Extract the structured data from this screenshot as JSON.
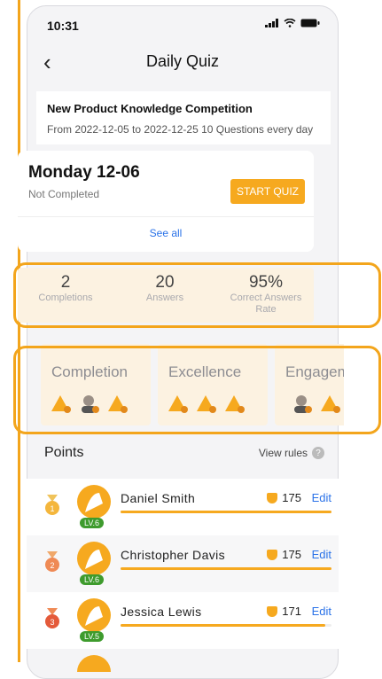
{
  "status_bar": {
    "time": "10:31"
  },
  "nav": {
    "title": "Daily Quiz",
    "back_icon": "chevron-left-icon"
  },
  "competition": {
    "title": "New Product Knowledge Competition",
    "dates": "From 2022-12-05 to 2022-12-25  10 Questions every day"
  },
  "today": {
    "day": "Monday 12-06",
    "status": "Not Completed",
    "start_label": "START QUIZ",
    "see_all": "See all"
  },
  "stats": [
    {
      "value": "2",
      "label": "Completions"
    },
    {
      "value": "20",
      "label": "Answers"
    },
    {
      "value": "95%",
      "label": "Correct Answers Rate"
    }
  ],
  "badges": [
    {
      "name": "Completion",
      "medals": [
        "1",
        "2",
        "3"
      ]
    },
    {
      "name": "Excellence",
      "medals": [
        "1",
        "2",
        "3"
      ]
    },
    {
      "name": "Engagem",
      "medals": [
        "1",
        "2",
        "3"
      ]
    }
  ],
  "points": {
    "title": "Points",
    "view_rules": "View rules",
    "rows": [
      {
        "rank": "1",
        "name": "Daniel Smith",
        "level": "LV.6",
        "score": "175",
        "edit": "Edit",
        "progress": 1.0
      },
      {
        "rank": "2",
        "name": "Christopher Davis",
        "level": "LV.6",
        "score": "175",
        "edit": "Edit",
        "progress": 1.0
      },
      {
        "rank": "3",
        "name": "Jessica Lewis",
        "level": "LV.5",
        "score": "171",
        "edit": "Edit",
        "progress": 0.97
      }
    ]
  },
  "colors": {
    "accent": "#f6a91f",
    "highlight": "#f3a51c",
    "link": "#2a72e8",
    "stats_bg": "#fcf2e1"
  }
}
